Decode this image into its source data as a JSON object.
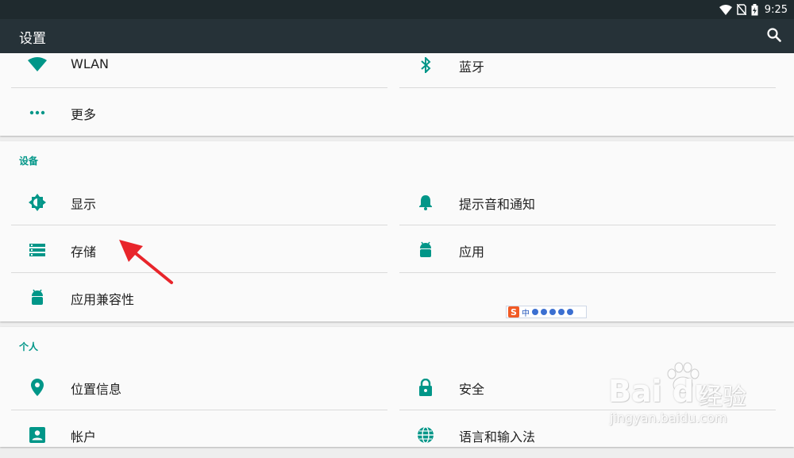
{
  "status_bar": {
    "time": "9:25",
    "icons": [
      "wifi-icon",
      "no-sim-icon",
      "battery-charging-icon"
    ]
  },
  "app_bar": {
    "title": "设置",
    "search_icon": "search-icon"
  },
  "sections": {
    "wireless": {
      "items": [
        {
          "label": "WLAN",
          "icon": "wifi-icon"
        },
        {
          "label": "蓝牙",
          "icon": "bluetooth-icon"
        },
        {
          "label": "更多",
          "icon": "more-icon"
        }
      ]
    },
    "device": {
      "header": "设备",
      "items": [
        {
          "label": "显示",
          "icon": "brightness-icon"
        },
        {
          "label": "提示音和通知",
          "icon": "bell-icon"
        },
        {
          "label": "存储",
          "icon": "storage-icon"
        },
        {
          "label": "应用",
          "icon": "android-icon"
        },
        {
          "label": "应用兼容性",
          "icon": "android-icon"
        }
      ]
    },
    "personal": {
      "header": "个人",
      "items": [
        {
          "label": "位置信息",
          "icon": "location-icon"
        },
        {
          "label": "安全",
          "icon": "lock-icon"
        },
        {
          "label": "帐户",
          "icon": "account-icon"
        },
        {
          "label": "语言和输入法",
          "icon": "globe-icon"
        }
      ]
    }
  },
  "ime_toolbar": {
    "logo": "S",
    "mode": "中"
  },
  "watermark": {
    "brand": "Bai du",
    "cn": "经验",
    "url": "jingyan.baidu.com"
  },
  "colors": {
    "accent": "#009688",
    "app_bar": "#263238",
    "status_bar": "#1f2a2e",
    "arrow": "#e8252b"
  }
}
